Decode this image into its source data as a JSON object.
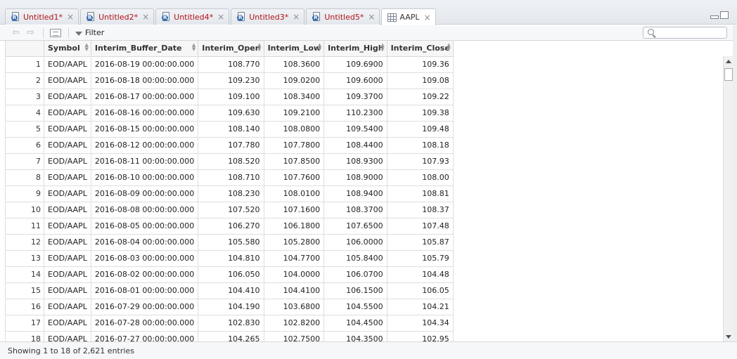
{
  "tabs": [
    {
      "label": "Untitled1*",
      "icon": "r-script-icon"
    },
    {
      "label": "Untitled2*",
      "icon": "r-script-icon"
    },
    {
      "label": "Untitled4*",
      "icon": "r-script-icon"
    },
    {
      "label": "Untitled3*",
      "icon": "r-script-icon"
    },
    {
      "label": "Untitled5*",
      "icon": "r-script-icon"
    },
    {
      "label": "AAPL",
      "icon": "data-grid-icon",
      "active": true
    }
  ],
  "tab_close": "×",
  "toolbar": {
    "filter_label": "Filter",
    "search_placeholder": ""
  },
  "table": {
    "columns": [
      "Symbol",
      "Interim_Buffer_Date",
      "Interim_Open",
      "Interim_Low",
      "Interim_High",
      "Interim_Close"
    ],
    "rows": [
      [
        "1",
        "EOD/AAPL",
        "2016-08-19 00:00:00.000",
        "108.770",
        "108.3600",
        "109.6900",
        "109.36"
      ],
      [
        "2",
        "EOD/AAPL",
        "2016-08-18 00:00:00.000",
        "109.230",
        "109.0200",
        "109.6000",
        "109.08"
      ],
      [
        "3",
        "EOD/AAPL",
        "2016-08-17 00:00:00.000",
        "109.100",
        "108.3400",
        "109.3700",
        "109.22"
      ],
      [
        "4",
        "EOD/AAPL",
        "2016-08-16 00:00:00.000",
        "109.630",
        "109.2100",
        "110.2300",
        "109.38"
      ],
      [
        "5",
        "EOD/AAPL",
        "2016-08-15 00:00:00.000",
        "108.140",
        "108.0800",
        "109.5400",
        "109.48"
      ],
      [
        "6",
        "EOD/AAPL",
        "2016-08-12 00:00:00.000",
        "107.780",
        "107.7800",
        "108.4400",
        "108.18"
      ],
      [
        "7",
        "EOD/AAPL",
        "2016-08-11 00:00:00.000",
        "108.520",
        "107.8500",
        "108.9300",
        "107.93"
      ],
      [
        "8",
        "EOD/AAPL",
        "2016-08-10 00:00:00.000",
        "108.710",
        "107.7600",
        "108.9000",
        "108.00"
      ],
      [
        "9",
        "EOD/AAPL",
        "2016-08-09 00:00:00.000",
        "108.230",
        "108.0100",
        "108.9400",
        "108.81"
      ],
      [
        "10",
        "EOD/AAPL",
        "2016-08-08 00:00:00.000",
        "107.520",
        "107.1600",
        "108.3700",
        "108.37"
      ],
      [
        "11",
        "EOD/AAPL",
        "2016-08-05 00:00:00.000",
        "106.270",
        "106.1800",
        "107.6500",
        "107.48"
      ],
      [
        "12",
        "EOD/AAPL",
        "2016-08-04 00:00:00.000",
        "105.580",
        "105.2800",
        "106.0000",
        "105.87"
      ],
      [
        "13",
        "EOD/AAPL",
        "2016-08-03 00:00:00.000",
        "104.810",
        "104.7700",
        "105.8400",
        "105.79"
      ],
      [
        "14",
        "EOD/AAPL",
        "2016-08-02 00:00:00.000",
        "106.050",
        "104.0000",
        "106.0700",
        "104.48"
      ],
      [
        "15",
        "EOD/AAPL",
        "2016-08-01 00:00:00.000",
        "104.410",
        "104.4100",
        "106.1500",
        "106.05"
      ],
      [
        "16",
        "EOD/AAPL",
        "2016-07-29 00:00:00.000",
        "104.190",
        "103.6800",
        "104.5500",
        "104.21"
      ],
      [
        "17",
        "EOD/AAPL",
        "2016-07-28 00:00:00.000",
        "102.830",
        "102.8200",
        "104.4500",
        "104.34"
      ],
      [
        "18",
        "EOD/AAPL",
        "2016-07-27 00:00:00.000",
        "104.265",
        "102.7500",
        "104.3500",
        "102.95"
      ]
    ]
  },
  "status": {
    "text": "Showing 1 to 18 of 2,621 entries"
  }
}
